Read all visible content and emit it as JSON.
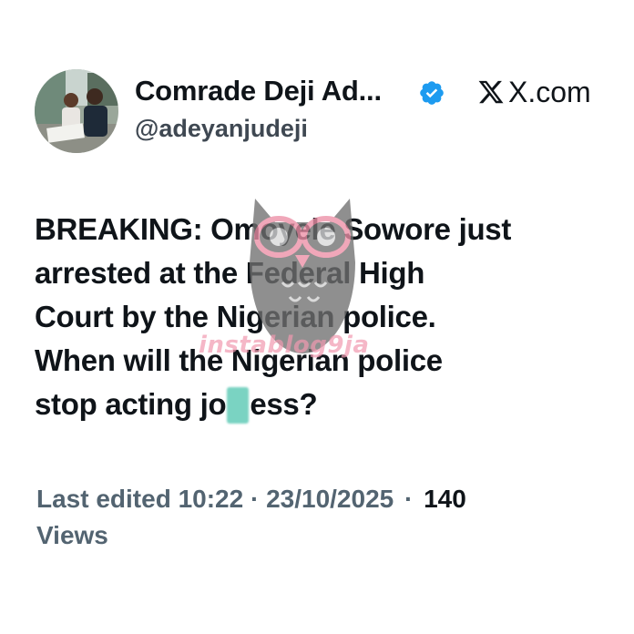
{
  "header": {
    "display_name": "Comrade Deji Ad...",
    "handle": "@adeyanjudeji",
    "domain": "X.com",
    "verified_icon": "verified-badge-icon",
    "brand_icon": "x-logo-icon",
    "verified_color": "#1d9bf0"
  },
  "tweet": {
    "lines": [
      "BREAKING: Omoyele Sowore just",
      "arrested at the Federal High",
      "Court by the Nigerian police.",
      "When will the Nigerian police"
    ],
    "last_line_start": "stop acting jo",
    "last_line_end": "ess?"
  },
  "meta": {
    "edited_label": "Last edited 10:22 · 23/10/2025",
    "separator": "·",
    "views_count": "140",
    "views_label": "Views"
  },
  "watermark": {
    "text": "instablog9ja"
  },
  "colors": {
    "text": "#0f1419",
    "secondary": "#536471",
    "watermark_pink": "#f19ab0",
    "blur_patch": "#7ad3c2"
  }
}
